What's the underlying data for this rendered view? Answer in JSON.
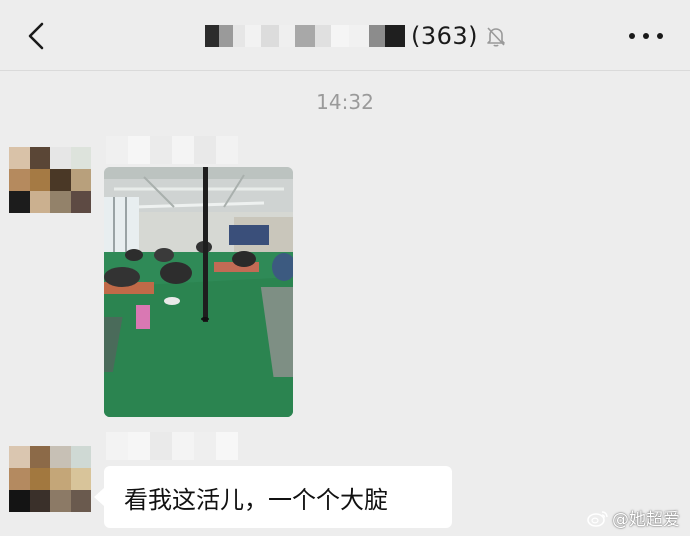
{
  "header": {
    "member_count": "(363)",
    "back_icon": "chevron-left-icon",
    "mute_icon": "bell-muted-icon",
    "more_icon": "more-dots-icon"
  },
  "chat": {
    "timestamp": "14:32",
    "messages": [
      {
        "type": "image",
        "content": "yoga class photo"
      },
      {
        "type": "text",
        "text": "看我这活儿，一个个大腚"
      }
    ]
  },
  "watermark": {
    "text": "@她超爱",
    "icon": "weibo-icon"
  },
  "colors": {
    "background": "#ededed",
    "bubble": "#ffffff",
    "timestamp": "#9a9a9a"
  }
}
